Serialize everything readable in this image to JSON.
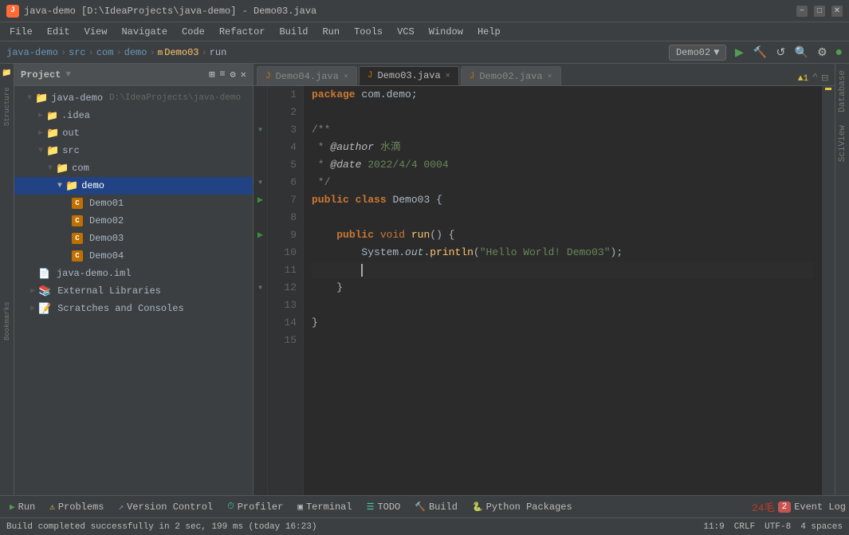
{
  "titleBar": {
    "title": "java-demo [D:\\IdeaProjects\\java-demo] - Demo03.java",
    "minimizeLabel": "−",
    "maximizeLabel": "□",
    "closeLabel": "✕"
  },
  "menuBar": {
    "items": [
      "File",
      "Edit",
      "View",
      "Navigate",
      "Code",
      "Refactor",
      "Build",
      "Run",
      "Tools",
      "VCS",
      "Window",
      "Help"
    ]
  },
  "toolbar": {
    "breadcrumb": [
      "java-demo",
      "src",
      "com",
      "demo",
      "Demo03",
      "run"
    ],
    "runConfig": "Demo02",
    "runLabel": "▶",
    "buildLabel": "🔨",
    "reloadLabel": "↺",
    "searchLabel": "🔍",
    "settingsLabel": "⚙"
  },
  "sidebar": {
    "projectLabel": "Project",
    "tree": [
      {
        "level": 0,
        "type": "root",
        "label": "java-demo",
        "path": "D:\\IdeaProjects\\java-demo",
        "expanded": true
      },
      {
        "level": 1,
        "type": "folder",
        "label": ".idea",
        "expanded": false
      },
      {
        "level": 1,
        "type": "folder",
        "label": "out",
        "expanded": false
      },
      {
        "level": 1,
        "type": "folder",
        "label": "src",
        "expanded": true
      },
      {
        "level": 2,
        "type": "folder",
        "label": "com",
        "expanded": true
      },
      {
        "level": 3,
        "type": "folder",
        "label": "demo",
        "expanded": true,
        "selected": true
      },
      {
        "level": 4,
        "type": "class",
        "label": "Demo01"
      },
      {
        "level": 4,
        "type": "class",
        "label": "Demo02"
      },
      {
        "level": 4,
        "type": "class",
        "label": "Demo03",
        "selected": true
      },
      {
        "level": 4,
        "type": "class",
        "label": "Demo04"
      },
      {
        "level": 1,
        "type": "iml",
        "label": "java-demo.iml"
      },
      {
        "level": 1,
        "type": "folder",
        "label": "External Libraries",
        "expanded": false
      },
      {
        "level": 1,
        "type": "folder",
        "label": "Scratches and Consoles",
        "expanded": false
      }
    ]
  },
  "tabs": [
    {
      "label": "Demo04.java",
      "active": false
    },
    {
      "label": "Demo03.java",
      "active": true
    },
    {
      "label": "Demo02.java",
      "active": false
    }
  ],
  "editor": {
    "warningCount": "▲1",
    "lines": [
      {
        "num": 1,
        "code": "package com.demo;"
      },
      {
        "num": 2,
        "code": ""
      },
      {
        "num": 3,
        "code": "/**"
      },
      {
        "num": 4,
        "code": " * @author 水滴"
      },
      {
        "num": 5,
        "code": " * @date 2022/4/4 0004"
      },
      {
        "num": 6,
        "code": " */"
      },
      {
        "num": 7,
        "code": "public class Demo03 {"
      },
      {
        "num": 8,
        "code": ""
      },
      {
        "num": 9,
        "code": "    public void run() {"
      },
      {
        "num": 10,
        "code": "        System.out.println(\"Hello World! Demo03\");"
      },
      {
        "num": 11,
        "code": ""
      },
      {
        "num": 12,
        "code": "    }"
      },
      {
        "num": 13,
        "code": ""
      },
      {
        "num": 14,
        "code": "}"
      },
      {
        "num": 15,
        "code": ""
      }
    ]
  },
  "rightPanels": [
    "Database",
    "SciView"
  ],
  "statusBar": {
    "message": "Build completed successfully in 2 sec, 199 ms (today 16:23)",
    "position": "11:9",
    "encoding": "CRLF",
    "charset": "UTF-8",
    "indent": "4 spaces"
  },
  "bottomToolbar": {
    "buttons": [
      {
        "icon": "▶",
        "label": "Run",
        "iconClass": "btn-icon"
      },
      {
        "icon": "⚠",
        "label": "Problems",
        "iconClass": "btn-icon warn"
      },
      {
        "icon": "↗",
        "label": "Version Control",
        "iconClass": "btn-icon ver"
      },
      {
        "icon": "⏱",
        "label": "Profiler",
        "iconClass": "btn-icon"
      },
      {
        "icon": "▣",
        "label": "Terminal",
        "iconClass": "btn-icon term"
      },
      {
        "icon": "☰",
        "label": "TODO",
        "iconClass": "btn-icon"
      },
      {
        "icon": "🔨",
        "label": "Build",
        "iconClass": "btn-icon build"
      },
      {
        "icon": "🐍",
        "label": "Python Packages",
        "iconClass": "btn-icon python"
      }
    ],
    "eventLogBadge": "2",
    "eventLogLabel": "Event Log"
  }
}
